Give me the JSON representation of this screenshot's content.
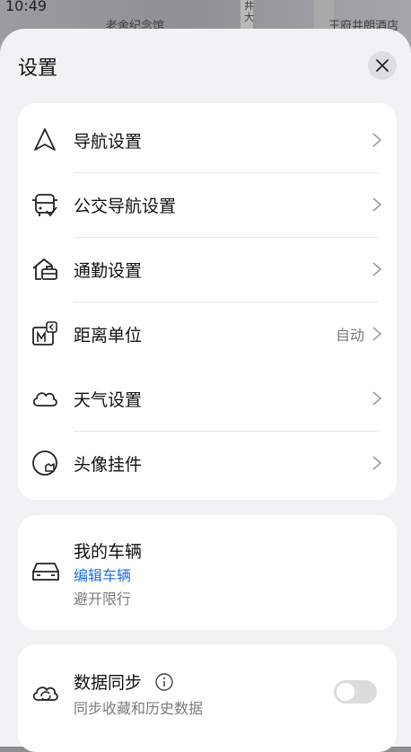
{
  "status": {
    "time": "10:49",
    "map_labels": [
      "老舍纪念馆",
      "井大",
      "王府井朗酒店"
    ]
  },
  "settings": {
    "title": "设置",
    "items": [
      {
        "label": "导航设置",
        "icon": "navigation-arrow-icon",
        "value": ""
      },
      {
        "label": "公交导航设置",
        "icon": "bus-icon",
        "value": ""
      },
      {
        "label": "通勤设置",
        "icon": "home-briefcase-icon",
        "value": ""
      },
      {
        "label": "距离单位",
        "icon": "distance-unit-icon",
        "value": "自动"
      },
      {
        "label": "天气设置",
        "icon": "cloud-icon",
        "value": ""
      },
      {
        "label": "头像挂件",
        "icon": "avatar-pendant-icon",
        "value": ""
      }
    ],
    "vehicle": {
      "title": "我的车辆",
      "link": "编辑车辆",
      "subtitle": "避开限行"
    },
    "sync": {
      "title": "数据同步",
      "subtitle": "同步收藏和历史数据",
      "enabled": false
    }
  },
  "colors": {
    "accent": "#1f6fe0",
    "card": "#ffffff",
    "sheet": "#f2f2f4",
    "muted": "#7b7b7b"
  }
}
